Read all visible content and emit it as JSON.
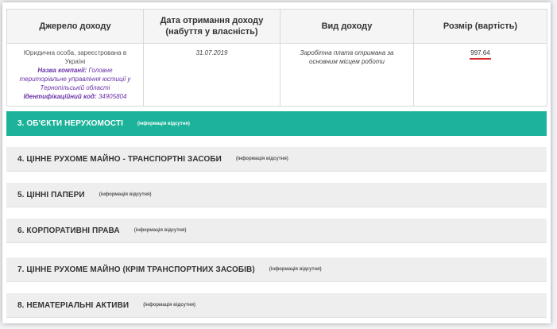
{
  "income_table": {
    "headers": {
      "source": "Джерело доходу",
      "date": "Дата отримання доходу (набуття у власність)",
      "kind": "Вид доходу",
      "amount": "Розмір (вартість)"
    },
    "row": {
      "entity": "Юридична особа, зареєстрована в Україні",
      "company_label": "Назва компанії:",
      "company_value": "Головне територіальне управління юстиції у Тернопільській області",
      "code_label": "Ідентифікаційний код:",
      "code_value": "34905804",
      "date": "31.07.2019",
      "kind": "Заробітна плата отримана за основним місцем роботи",
      "amount": "997.64"
    }
  },
  "sections": [
    {
      "title": "3. ОБ'ЄКТИ НЕРУХОМОСТІ",
      "note": "(інформація відсутня)"
    },
    {
      "title": "4. ЦІННЕ РУХОМЕ МАЙНО - ТРАНСПОРТНІ ЗАСОБИ",
      "note": "(інформація відсутня)"
    },
    {
      "title": "5. ЦІННІ ПАПЕРИ",
      "note": "(інформація відсутня)"
    },
    {
      "title": "6. КОРПОРАТИВНІ ПРАВА",
      "note": "(інформація відсутня)"
    },
    {
      "title": "7. ЦІННЕ РУХОМЕ МАЙНО (КРІМ ТРАНСПОРТНИХ ЗАСОБІВ)",
      "note": "(інформація відсутня)"
    },
    {
      "title": "8. НЕМАТЕРІАЛЬНІ АКТИВИ",
      "note": "(інформація відсутня)"
    }
  ],
  "colors": {
    "active_section": "#1db39b",
    "section_bg": "#eeeeee",
    "link_purple": "#6a32a8",
    "amount_underline": "#d62b2b"
  }
}
